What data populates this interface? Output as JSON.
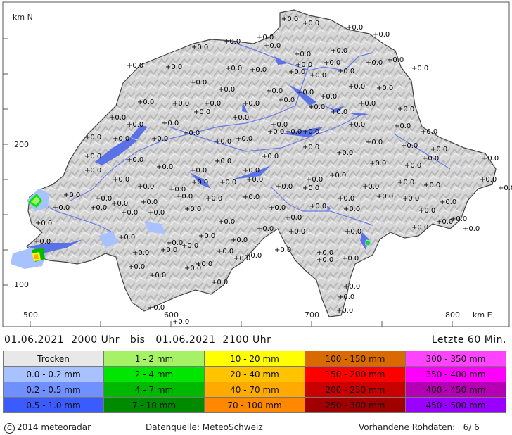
{
  "map": {
    "axis_y_label": "km N",
    "axis_x_label": "km E",
    "y_ticks": [
      "200",
      "100"
    ],
    "x_ticks": [
      "500",
      "600",
      "700",
      "800"
    ],
    "station_value": "0.0",
    "colors": {
      "border": "#444444",
      "terrain": "#d4d4d4",
      "lakes": "#5a72e6",
      "rivers": "#6a7ae8"
    }
  },
  "period": {
    "from": "01.06.2021",
    "from_time": "2000 Uhr",
    "sep": "bis",
    "to": "01.06.2021",
    "to_time": "2100 Uhr"
  },
  "last": "Letzte 60 Min.",
  "legend": {
    "rows": [
      [
        {
          "label": "Trocken",
          "color": "#e8e8e8"
        },
        {
          "label": "1 - 2 mm",
          "color": "#a6f266"
        },
        {
          "label": "10 - 20 mm",
          "color": "#ffff00"
        },
        {
          "label": "100 - 150 mm",
          "color": "#d96a00"
        },
        {
          "label": "300 - 350 mm",
          "color": "#ff44ff"
        }
      ],
      [
        {
          "label": "0.0 - 0.2 mm",
          "color": "#a8c2ff"
        },
        {
          "label": "2 - 4 mm",
          "color": "#00e600"
        },
        {
          "label": "20 - 40 mm",
          "color": "#ffc400"
        },
        {
          "label": "150 - 200 mm",
          "color": "#ff0000"
        },
        {
          "label": "350 - 400 mm",
          "color": "#ff00ff"
        }
      ],
      [
        {
          "label": "0.2 - 0.5 mm",
          "color": "#7090ff"
        },
        {
          "label": "4 - 7 mm",
          "color": "#00b800"
        },
        {
          "label": "40 - 70 mm",
          "color": "#ffaa00"
        },
        {
          "label": "200 - 250 mm",
          "color": "#c80000"
        },
        {
          "label": "400 - 450 mm",
          "color": "#b200b2"
        }
      ],
      [
        {
          "label": "0.5 - 1.0 mm",
          "color": "#3a5cff"
        },
        {
          "label": "7 - 10 mm",
          "color": "#008a00"
        },
        {
          "label": "70 - 100 mm",
          "color": "#ff8800"
        },
        {
          "label": "250 - 300 mm",
          "color": "#a00000"
        },
        {
          "label": "450 - 500 mm",
          "color": "#9900ff"
        }
      ]
    ]
  },
  "footer": {
    "copyright_symbol": "C",
    "copyright": "2014  meteoradar",
    "source": "Datenquelle: MeteoSchweiz",
    "raw_label": "Vorhandene Rohdaten:",
    "raw_value": "6/  6"
  }
}
